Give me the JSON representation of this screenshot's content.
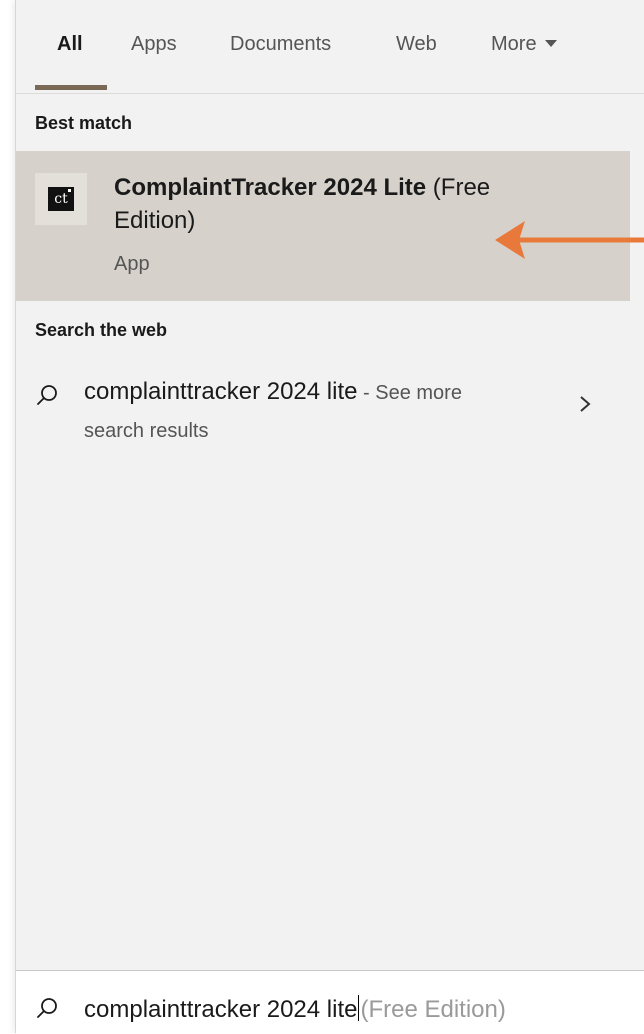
{
  "tabs": [
    {
      "label": "All",
      "active": true
    },
    {
      "label": "Apps",
      "active": false
    },
    {
      "label": "Documents",
      "active": false
    },
    {
      "label": "Web",
      "active": false
    },
    {
      "label": "More",
      "active": false
    }
  ],
  "best_match": {
    "section_title": "Best match",
    "app_name_bold": "ComplaintTracker 2024 Lite",
    "app_name_suffix": " (Free",
    "app_name_line2": "Edition)",
    "app_type": "App",
    "icon_text": "ct",
    "icon_name": "app-icon"
  },
  "web": {
    "section_title": "Search the web",
    "query": "complainttracker 2024 lite",
    "see_more": " - See more",
    "line2": "search results"
  },
  "search_box": {
    "typed": "complainttracker 2024 lite",
    "suggestion": "(Free Edition)"
  },
  "colors": {
    "panel_bg": "#f2f2f2",
    "selected_bg": "#d6d2cb",
    "tab_underline": "#7a6a55",
    "annotation_arrow": "#e8793a"
  }
}
